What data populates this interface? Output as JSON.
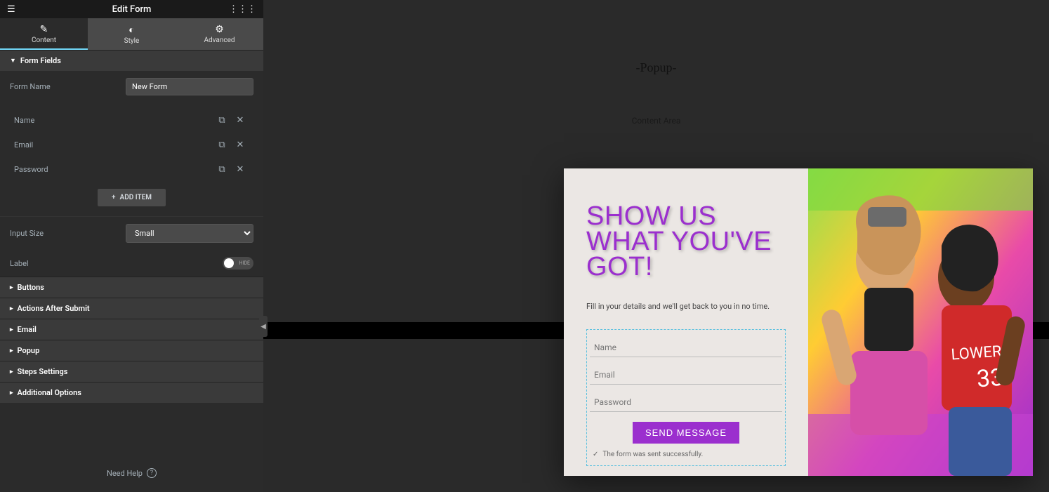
{
  "header": {
    "title": "Edit Form"
  },
  "tabs": {
    "content": "Content",
    "style": "Style",
    "advanced": "Advanced"
  },
  "formFields": {
    "title": "Form Fields",
    "nameLabel": "Form Name",
    "nameValue": "New Form",
    "items": [
      {
        "label": "Name"
      },
      {
        "label": "Email"
      },
      {
        "label": "Password"
      }
    ],
    "addItem": "ADD ITEM",
    "inputSizeLabel": "Input Size",
    "inputSizeValue": "Small",
    "labelLabel": "Label",
    "labelToggle": "HIDE"
  },
  "sections": {
    "buttons": "Buttons",
    "actionsAfter": "Actions After Submit",
    "email": "Email",
    "popup": "Popup",
    "steps": "Steps Settings",
    "additional": "Additional Options"
  },
  "help": "Need Help",
  "canvas": {
    "title": "-Popup-",
    "sub": "Content Area"
  },
  "popup": {
    "title": "SHOW US WHAT YOU'VE GOT!",
    "desc": "Fill in your details and we'll get back to you in no time.",
    "placeholders": {
      "name": "Name",
      "email": "Email",
      "password": "Password"
    },
    "button": "SEND MESSAGE",
    "success": "The form was sent successfully."
  }
}
